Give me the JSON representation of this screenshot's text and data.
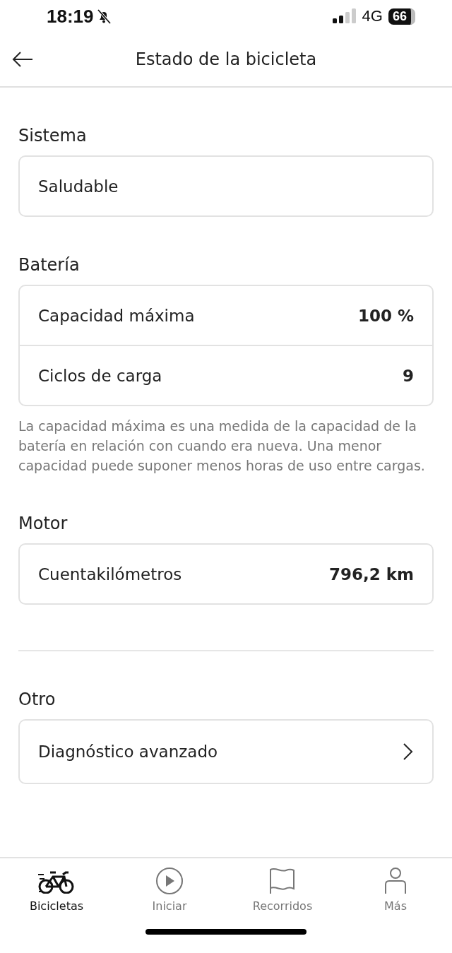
{
  "status_bar": {
    "time": "18:19",
    "network": "4G",
    "battery": "66"
  },
  "header": {
    "title": "Estado de la bicicleta"
  },
  "sections": [
    {
      "title": "Sistema",
      "rows": [
        {
          "kind": "value",
          "label": "Saludable"
        }
      ]
    },
    {
      "title": "Batería",
      "rows": [
        {
          "kind": "value",
          "label": "Capacidad máxima",
          "value": "100 %"
        },
        {
          "kind": "value",
          "label": "Ciclos de carga",
          "value": "9"
        }
      ],
      "note": "La capacidad máxima es una medida de la capacidad de la batería en relación con cuando era nueva. Una menor capacidad puede suponer menos horas de uso entre cargas."
    },
    {
      "title": "Motor",
      "rows": [
        {
          "kind": "value",
          "label": "Cuentakilómetros",
          "value": "796,2 km"
        }
      ]
    },
    {
      "title": "Otro",
      "divider_before": true,
      "rows": [
        {
          "kind": "link",
          "label": "Diagnóstico avanzado"
        }
      ]
    }
  ],
  "tab_bar": [
    {
      "kind": "bike",
      "label": "Bicicletas",
      "selected": true
    },
    {
      "kind": "play",
      "label": "Iniciar",
      "selected": false
    },
    {
      "kind": "flag",
      "label": "Recorridos",
      "selected": false
    },
    {
      "kind": "person",
      "label": "Más",
      "selected": false
    }
  ]
}
